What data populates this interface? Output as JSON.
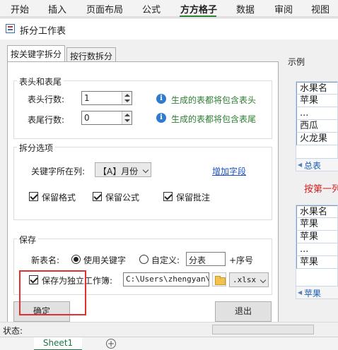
{
  "ribbon": {
    "tabs": [
      "开始",
      "插入",
      "页面布局",
      "公式",
      "方方格子",
      "数据",
      "审阅",
      "视图"
    ],
    "active": "方方格子"
  },
  "dialog": {
    "title": "拆分工作表",
    "tabs": [
      "按关键字拆分",
      "按行数拆分"
    ],
    "header_footer": {
      "group_label": "表头和表尾",
      "header_rows_label": "表头行数:",
      "header_rows_value": "1",
      "header_hint": "生成的表都将包含表头",
      "footer_rows_label": "表尾行数:",
      "footer_rows_value": "0",
      "footer_hint": "生成的表都将包含表尾"
    },
    "split_options": {
      "group_label": "拆分选项",
      "key_column_label": "关键字所在列:",
      "key_column_value": "【A】月份",
      "add_field_link": "增加字段",
      "keep_format": "保留格式",
      "keep_formula": "保留公式",
      "keep_comment": "保留批注"
    },
    "save": {
      "group_label": "保存",
      "new_sheet_name_label": "新表名:",
      "use_keyword": "使用关键字",
      "custom": "自定义:",
      "custom_value": "分表",
      "suffix": "+序号",
      "save_independent": "保存为独立工作簿:",
      "path_value": "C:\\Users\\zhengyan\\Desktop",
      "ext_value": ".xlsx"
    },
    "ok_button": "确定",
    "exit_button": "退出",
    "example": {
      "label": "示例",
      "sheet1_rows": [
        "水果名",
        "苹果",
        "...",
        "西瓜",
        "火龙果"
      ],
      "sheet1_tab": "总表",
      "note": "按第一列",
      "sheet2_rows": [
        "水果名",
        "苹果",
        "苹果",
        "...",
        "苹果"
      ],
      "sheet2_tab": "苹果"
    },
    "status_label": "状态:"
  },
  "sheet_tabs": {
    "sheet": "Sheet1",
    "add": "+"
  }
}
